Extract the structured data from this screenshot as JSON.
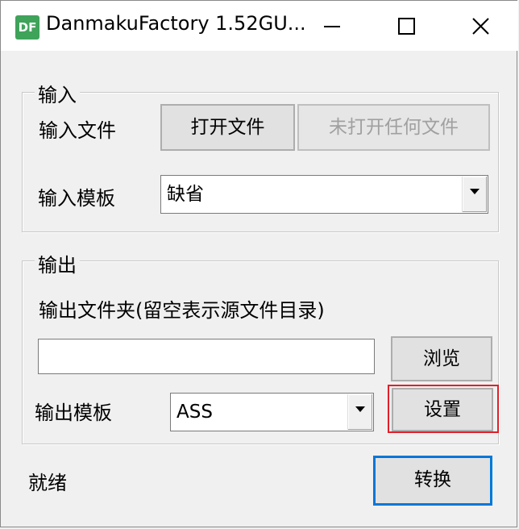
{
  "window": {
    "title": "DanmakuFactory 1.52GU...",
    "icon_text": "DF",
    "icon_color": "#3fa35a"
  },
  "input_group": {
    "title": "输入",
    "file_label": "输入文件",
    "open_button": "打开文件",
    "file_status_button": "未打开任何文件",
    "template_label": "输入模板",
    "template_value": "缺省"
  },
  "output_group": {
    "title": "输出",
    "folder_label": "输出文件夹(留空表示源文件目录)",
    "folder_value": "",
    "browse_button": "浏览",
    "template_label": "输出模板",
    "template_value": "ASS",
    "settings_button": "设置"
  },
  "status": {
    "text": "就绪"
  },
  "convert_button": "转换",
  "highlight_color": "#e0202a"
}
